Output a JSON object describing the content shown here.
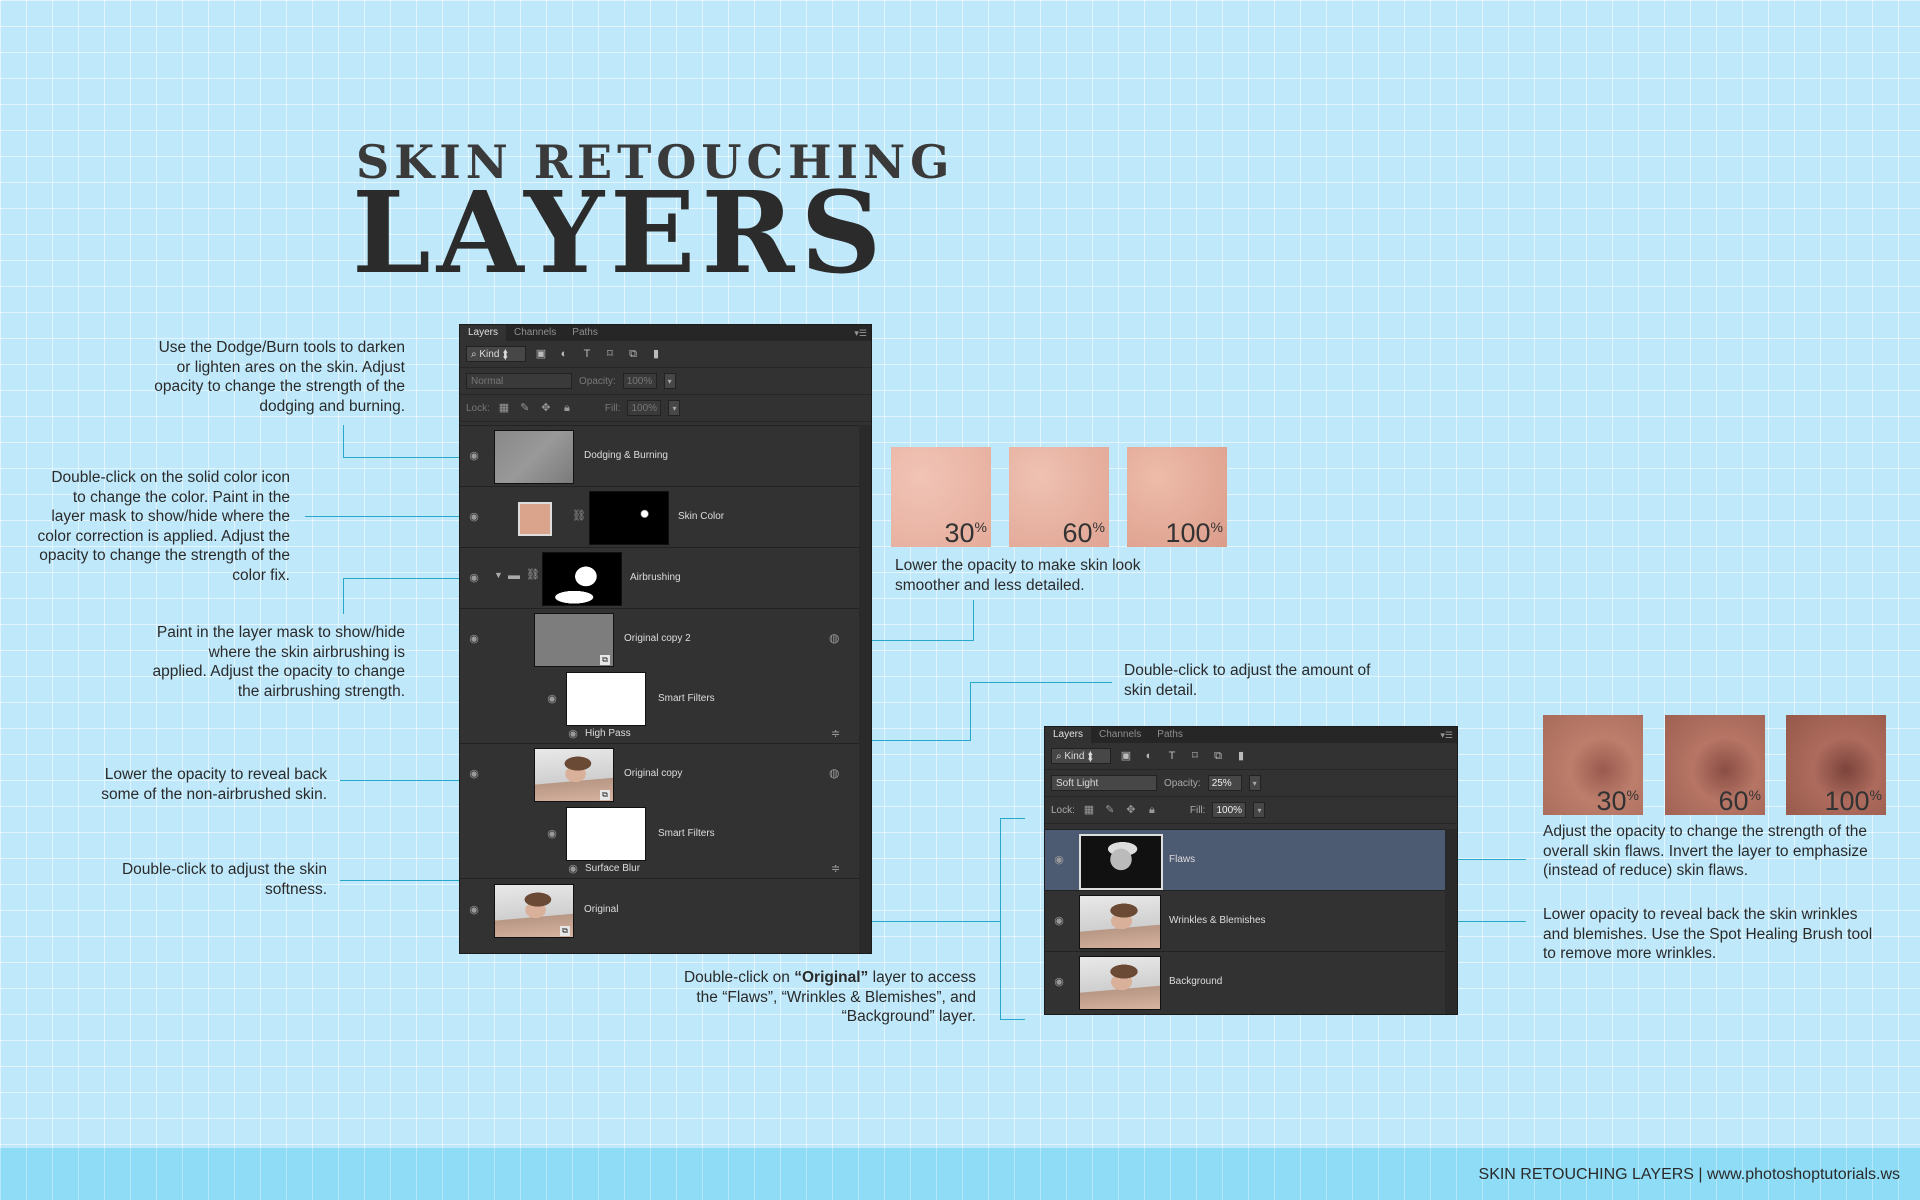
{
  "title": {
    "line1": "SKIN RETOUCHING",
    "line2": "LAYERS"
  },
  "annotations": {
    "dodge_burn": "Use the Dodge/Burn tools to darken\nor lighten ares on the skin. Adjust\nopacity to change the strength of the\ndodging and burning.",
    "skin_color": "Double-click on the solid color icon\nto change the color. Paint in the\nlayer mask to show/hide where the\ncolor correction is applied. Adjust the\nopacity to change the strength of the\ncolor fix.",
    "airbrush": "Paint in the layer mask to show/hide\nwhere the skin airbrushing is\napplied. Adjust the opacity to change\nthe airbrushing strength.",
    "orig_copy": "Lower the opacity to reveal back\nsome of the non-airbrushed skin.",
    "surface_blur": "Double-click to adjust the skin\nsoftness.",
    "opacity_smoother": "Lower the opacity to make skin look\nsmoother and less detailed.",
    "high_pass": "Double-click to adjust the amount of\nskin detail.",
    "original_prefix": "Double-click on ",
    "original_bold": "“Original”",
    "original_suffix": " layer to access\nthe “Flaws”, “Wrinkles & Blemishes”, and\n“Background” layer.",
    "flaws": "Adjust the opacity to change the strength of the\noverall skin flaws. Invert the layer to emphasize\n(instead of reduce) skin flaws.",
    "wrinkles": "Lower opacity to reveal back the skin wrinkles\nand blemishes. Use the Spot Healing Brush tool\nto remove more wrinkles."
  },
  "panel1": {
    "tabs": [
      "Layers",
      "Channels",
      "Paths"
    ],
    "filter": "Kind",
    "blend_mode": "Normal",
    "opacity_label": "Opacity:",
    "opacity": "100%",
    "lock_label": "Lock:",
    "fill_label": "Fill:",
    "fill": "100%",
    "layers": {
      "dodging": "Dodging & Burning",
      "skin_color": "Skin Color",
      "airbrushing": "Airbrushing",
      "orig_copy2": "Original copy 2",
      "smart_filters_1": "Smart Filters",
      "high_pass": "High Pass",
      "orig_copy": "Original copy",
      "smart_filters_2": "Smart Filters",
      "surface_blur": "Surface Blur",
      "original": "Original"
    }
  },
  "panel2": {
    "tabs": [
      "Layers",
      "Channels",
      "Paths"
    ],
    "filter": "Kind",
    "blend_mode": "Soft Light",
    "opacity_label": "Opacity:",
    "opacity": "25%",
    "lock_label": "Lock:",
    "fill_label": "Fill:",
    "fill": "100%",
    "layers": {
      "flaws": "Flaws",
      "wrinkles": "Wrinkles & Blemishes",
      "background": "Background"
    }
  },
  "samples_top": [
    {
      "pct": "30",
      "sym": "%"
    },
    {
      "pct": "60",
      "sym": "%"
    },
    {
      "pct": "100",
      "sym": "%"
    }
  ],
  "samples_bottom": [
    {
      "pct": "30",
      "sym": "%"
    },
    {
      "pct": "60",
      "sym": "%"
    },
    {
      "pct": "100",
      "sym": "%"
    }
  ],
  "colors": {
    "background": "#bfe9fb",
    "leader_line": "#2aa8cc",
    "panel": "#323232",
    "swatch": "#d9a48b",
    "selected_layer": "#4c5a72"
  },
  "footer": "SKIN RETOUCHING LAYERS | www.photoshoptutorials.ws"
}
